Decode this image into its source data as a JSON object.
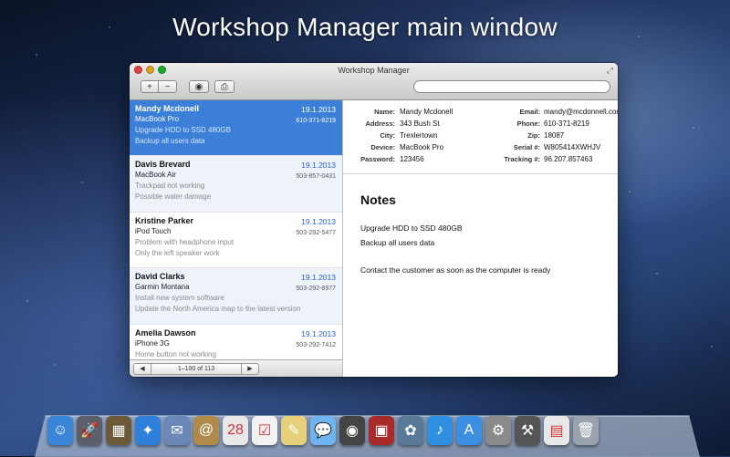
{
  "banner": {
    "title": "Workshop Manager main window"
  },
  "window": {
    "title": "Workshop Manager",
    "toolbar": {
      "add_label": "+",
      "remove_label": "−"
    },
    "search": {
      "placeholder": ""
    }
  },
  "list": {
    "items": [
      {
        "name": "Mandy Mcdonell",
        "date": "19.1.2013",
        "device": "MacBook Pro",
        "phone": "610-371-8219",
        "note1": "Upgrade HDD to SSD 480GB",
        "note2": "Backup all users data"
      },
      {
        "name": "Davis Brevard",
        "date": "19.1.2013",
        "device": "MacBook Air",
        "phone": "503-857-0431",
        "note1": "Trackpad not working",
        "note2": "Possible water damage"
      },
      {
        "name": "Kristine Parker",
        "date": "19.1.2013",
        "device": "iPod Touch",
        "phone": "503-292-5477",
        "note1": "Problem with headphone input",
        "note2": "Only the left speaker work"
      },
      {
        "name": "David Clarks",
        "date": "19.1.2013",
        "device": "Garmin Montana",
        "phone": "503-292-8977",
        "note1": "Install new system software",
        "note2": "Update the North America map to the latest version"
      },
      {
        "name": "Amelia Dawson",
        "date": "19.1.2013",
        "device": "iPhone 3G",
        "phone": "503-292-7412",
        "note1": "Home button not working",
        "note2": ""
      }
    ],
    "pager": {
      "prev": "◀",
      "info": "1–100 of 113",
      "next": "▶"
    }
  },
  "detail": {
    "left_fields": [
      {
        "label": "Name:",
        "value": "Mandy Mcdonell"
      },
      {
        "label": "Address:",
        "value": "343 Bush St"
      },
      {
        "label": "City:",
        "value": "Trexlertown"
      },
      {
        "label": "Device:",
        "value": "MacBook Pro"
      },
      {
        "label": "Password:",
        "value": "123456"
      }
    ],
    "right_fields": [
      {
        "label": "Email:",
        "value": "mandy@mcdonnell.com"
      },
      {
        "label": "Phone:",
        "value": "610-371-8219"
      },
      {
        "label": "Zip:",
        "value": "18087"
      },
      {
        "label": "Serial #:",
        "value": "W805414XWHJV"
      },
      {
        "label": "Tracking #:",
        "value": "96.207.857463"
      }
    ],
    "notes_title": "Notes",
    "notes": [
      "Upgrade HDD to SSD 480GB",
      "Backup all users data",
      "Contact the customer as soon as the computer is ready"
    ]
  },
  "dock": {
    "icons": [
      {
        "name": "finder-icon",
        "glyph": "☺",
        "color": "#3a86d6"
      },
      {
        "name": "launchpad-icon",
        "glyph": "🚀",
        "color": "#5a5f6a"
      },
      {
        "name": "mission-control-icon",
        "glyph": "▦",
        "color": "#6b5a3a"
      },
      {
        "name": "safari-icon",
        "glyph": "✦",
        "color": "#2f80d8"
      },
      {
        "name": "mail-icon",
        "glyph": "✉",
        "color": "#6a88b8"
      },
      {
        "name": "contacts-icon",
        "glyph": "@",
        "color": "#b08a4a"
      },
      {
        "name": "calendar-icon",
        "glyph": "28",
        "color": "#e8e8e8"
      },
      {
        "name": "reminders-icon",
        "glyph": "☑",
        "color": "#f2f2f2"
      },
      {
        "name": "notes-icon",
        "glyph": "✎",
        "color": "#e6cf7a"
      },
      {
        "name": "messages-icon",
        "glyph": "💬",
        "color": "#6fb3ef"
      },
      {
        "name": "facetime-icon",
        "glyph": "◉",
        "color": "#444"
      },
      {
        "name": "photo-booth-icon",
        "glyph": "▣",
        "color": "#a92a2a"
      },
      {
        "name": "iphoto-icon",
        "glyph": "✿",
        "color": "#5a7a9a"
      },
      {
        "name": "itunes-icon",
        "glyph": "♪",
        "color": "#2f8fe0"
      },
      {
        "name": "app-store-icon",
        "glyph": "A",
        "color": "#3a8fe0"
      },
      {
        "name": "system-preferences-icon",
        "glyph": "⚙",
        "color": "#8a8a8a"
      },
      {
        "name": "workshop-manager-icon",
        "glyph": "⚒",
        "color": "#555"
      },
      {
        "name": "documents-icon",
        "glyph": "▤",
        "color": "#e8e8e8"
      },
      {
        "name": "trash-icon",
        "glyph": "🗑",
        "color": "#9aa3ad"
      }
    ]
  }
}
